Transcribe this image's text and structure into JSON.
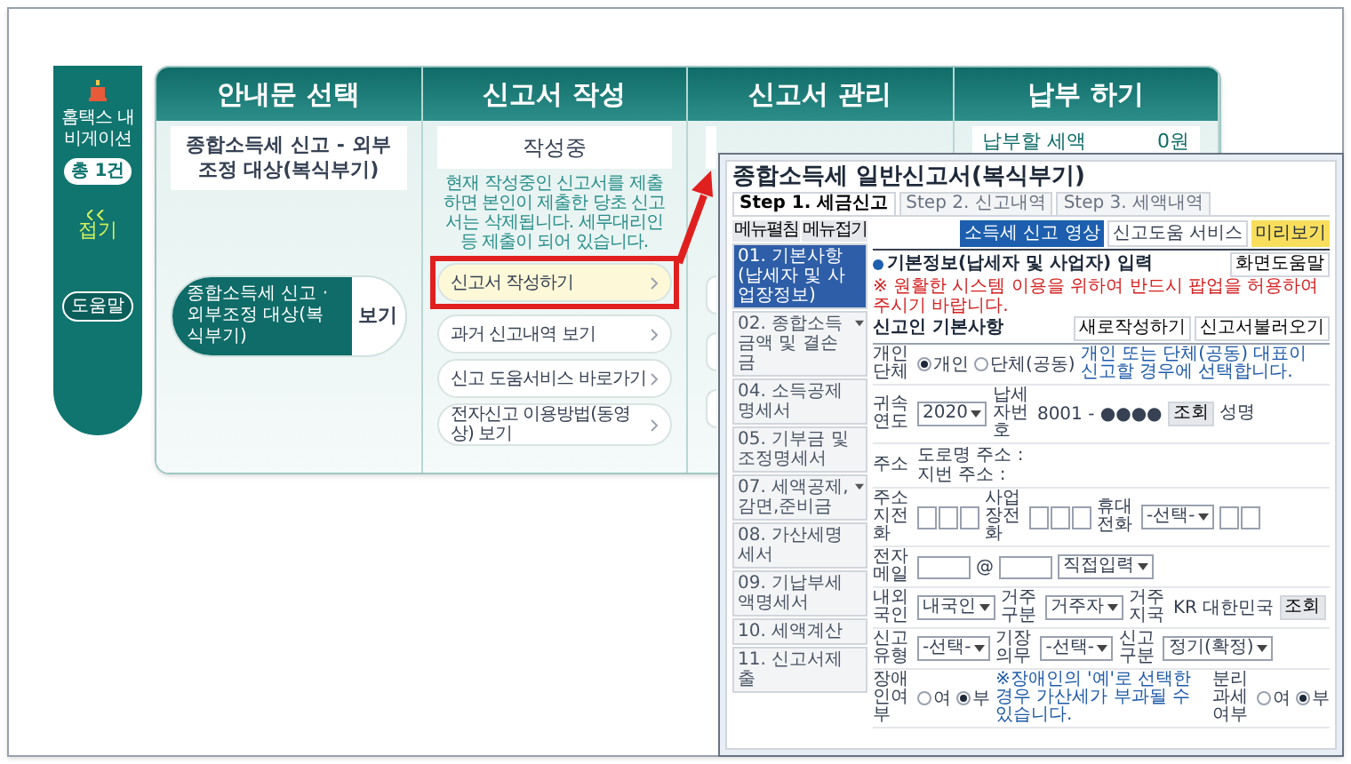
{
  "nav": {
    "title": "홈택스 내비게이션",
    "count": "총 1건",
    "collapse": "접기",
    "help": "도움말"
  },
  "steps": [
    {
      "kind": "guide",
      "title": "안내문 선택",
      "card": "종합소득세 신고 - 외부조정 대상(복식부기)",
      "item_label": "종합소득세 신고 · 외부조정 대상(복식부기)",
      "item_button": "보기"
    },
    {
      "kind": "write",
      "title": "신고서 작성",
      "card": "작성중",
      "notice": "현재 작성중인 신고서를 제출하면 본인이 제출한 당초 신고서는 삭제됩니다. 세무대리인 등 제출이 되어 있습니다.",
      "actions": [
        {
          "label": "신고서 작성하기",
          "selected": true
        },
        {
          "label": "과거 신고내역 보기",
          "selected": false
        },
        {
          "label": "신고 도움서비스 바로가기",
          "selected": false
        },
        {
          "label": "전자신고 이용방법(동영상) 보기",
          "selected": false
        }
      ]
    },
    {
      "kind": "manage",
      "title": "신고서 관리"
    },
    {
      "kind": "pay",
      "title": "납부 하기",
      "amount_label": "납부할 세액",
      "amount": "0원"
    }
  ],
  "form_window": {
    "title": "종합소득세 일반신고서(복식부기)",
    "tabs": [
      {
        "label": "Step 1. 세금신고",
        "selected": true
      },
      {
        "label": "Step 2. 신고내역",
        "selected": false
      },
      {
        "label": "Step 3. 세액내역",
        "selected": false
      }
    ],
    "menu_buttons": [
      "메뉴펼침",
      "메뉴접기"
    ],
    "sidebar": [
      {
        "label": "01. 기본사항(납세자 및 사업장정보)",
        "selected": true,
        "expandable": false
      },
      {
        "label": "02. 종합소득금액 및 결손금",
        "selected": false,
        "expandable": true
      },
      {
        "label": "04. 소득공제명세서",
        "selected": false,
        "expandable": false
      },
      {
        "label": "05. 기부금 및 조정명세서",
        "selected": false,
        "expandable": false
      },
      {
        "label": "07. 세액공제,감면,준비금",
        "selected": false,
        "expandable": true
      },
      {
        "label": "08. 가산세명세서",
        "selected": false,
        "expandable": false
      },
      {
        "label": "09. 기납부세액명세서",
        "selected": false,
        "expandable": false
      },
      {
        "label": "10. 세액계산",
        "selected": false,
        "expandable": false
      },
      {
        "label": "11. 신고서제출",
        "selected": false,
        "expandable": false
      }
    ],
    "toolbar": [
      {
        "kind": "primary",
        "label": "소득세 신고 영상"
      },
      {
        "kind": "plain",
        "label": "신고도움 서비스"
      },
      {
        "kind": "highlight",
        "label": "미리보기"
      }
    ],
    "section_title": "기본정보(납세자 및 사업자) 입력",
    "section_button": "화면도움말",
    "notice": "※ 원활한 시스템 이용을 위하여 반드시 팝업을 허용하여 주시기 바랍니다.",
    "subsection": "신고인 기본사항",
    "subsection_buttons": [
      "새로작성하기",
      "신고서불러오기"
    ],
    "form_rows": [
      {
        "fields": [
          {
            "label": "개인단체",
            "controls": [
              {
                "kind": "radio",
                "options": [
                  {
                    "label": "개인",
                    "selected": true
                  },
                  {
                    "label": "단체(공동)",
                    "selected": false
                  }
                ]
              },
              {
                "kind": "note",
                "text": "개인 또는 단체(공동) 대표이 신고할 경우에 선택합니다."
              }
            ]
          }
        ]
      },
      {
        "fields": [
          {
            "label": "귀속연도",
            "controls": [
              {
                "kind": "select",
                "value": "2020"
              }
            ]
          },
          {
            "label": "납세자번호",
            "controls": [
              {
                "kind": "text",
                "text": "8001 - ●●●●"
              },
              {
                "kind": "button",
                "text": "조회"
              }
            ]
          },
          {
            "label": "성명"
          }
        ]
      },
      {
        "fields": [
          {
            "label": "주소",
            "controls": [
              {
                "kind": "lines",
                "lines": [
                  "도로명 주소 :",
                  "지번 주소 :"
                ]
              }
            ]
          }
        ]
      },
      {
        "fields": [
          {
            "label": "주소지전화",
            "controls": [
              {
                "kind": "phone"
              }
            ]
          },
          {
            "label": "사업장전화",
            "controls": [
              {
                "kind": "phone"
              }
            ]
          },
          {
            "label": "휴대전화",
            "controls": [
              {
                "kind": "select",
                "value": "-선택-"
              },
              {
                "kind": "phone2"
              }
            ]
          }
        ]
      },
      {
        "fields": [
          {
            "label": "전자메일",
            "controls": [
              {
                "kind": "input"
              },
              {
                "kind": "text",
                "text": "@"
              },
              {
                "kind": "input"
              },
              {
                "kind": "select",
                "value": "직접입력"
              }
            ]
          }
        ]
      },
      {
        "fields": [
          {
            "label": "내외국인",
            "controls": [
              {
                "kind": "select",
                "value": "내국인"
              }
            ]
          },
          {
            "label": "거주구분",
            "controls": [
              {
                "kind": "select",
                "value": "거주자"
              }
            ]
          },
          {
            "label": "거주지국",
            "controls": [
              {
                "kind": "text",
                "text": "KR"
              },
              {
                "kind": "text",
                "text": "대한민국"
              },
              {
                "kind": "button",
                "text": "조회"
              }
            ]
          }
        ]
      },
      {
        "fields": [
          {
            "label": "신고유형",
            "controls": [
              {
                "kind": "select",
                "value": "-선택-"
              }
            ]
          },
          {
            "label": "기장의무",
            "controls": [
              {
                "kind": "select",
                "value": "-선택-"
              }
            ]
          },
          {
            "label": "신고구분",
            "controls": [
              {
                "kind": "select",
                "value": "정기(확정)"
              }
            ]
          }
        ]
      },
      {
        "fields": [
          {
            "label": "장애인여부",
            "controls": [
              {
                "kind": "radio",
                "options": [
                  {
                    "label": "여",
                    "selected": false
                  },
                  {
                    "label": "부",
                    "selected": true
                  }
                ]
              },
              {
                "kind": "note",
                "text": "※장애인의 '예'로 선택한 경우 가산세가 부과될 수 있습니다."
              }
            ]
          },
          {
            "label": "분리과세 여부",
            "controls": [
              {
                "kind": "radio",
                "options": [
                  {
                    "label": "여",
                    "selected": false
                  },
                  {
                    "label": "부",
                    "selected": true
                  }
                ]
              }
            ]
          }
        ]
      }
    ]
  }
}
